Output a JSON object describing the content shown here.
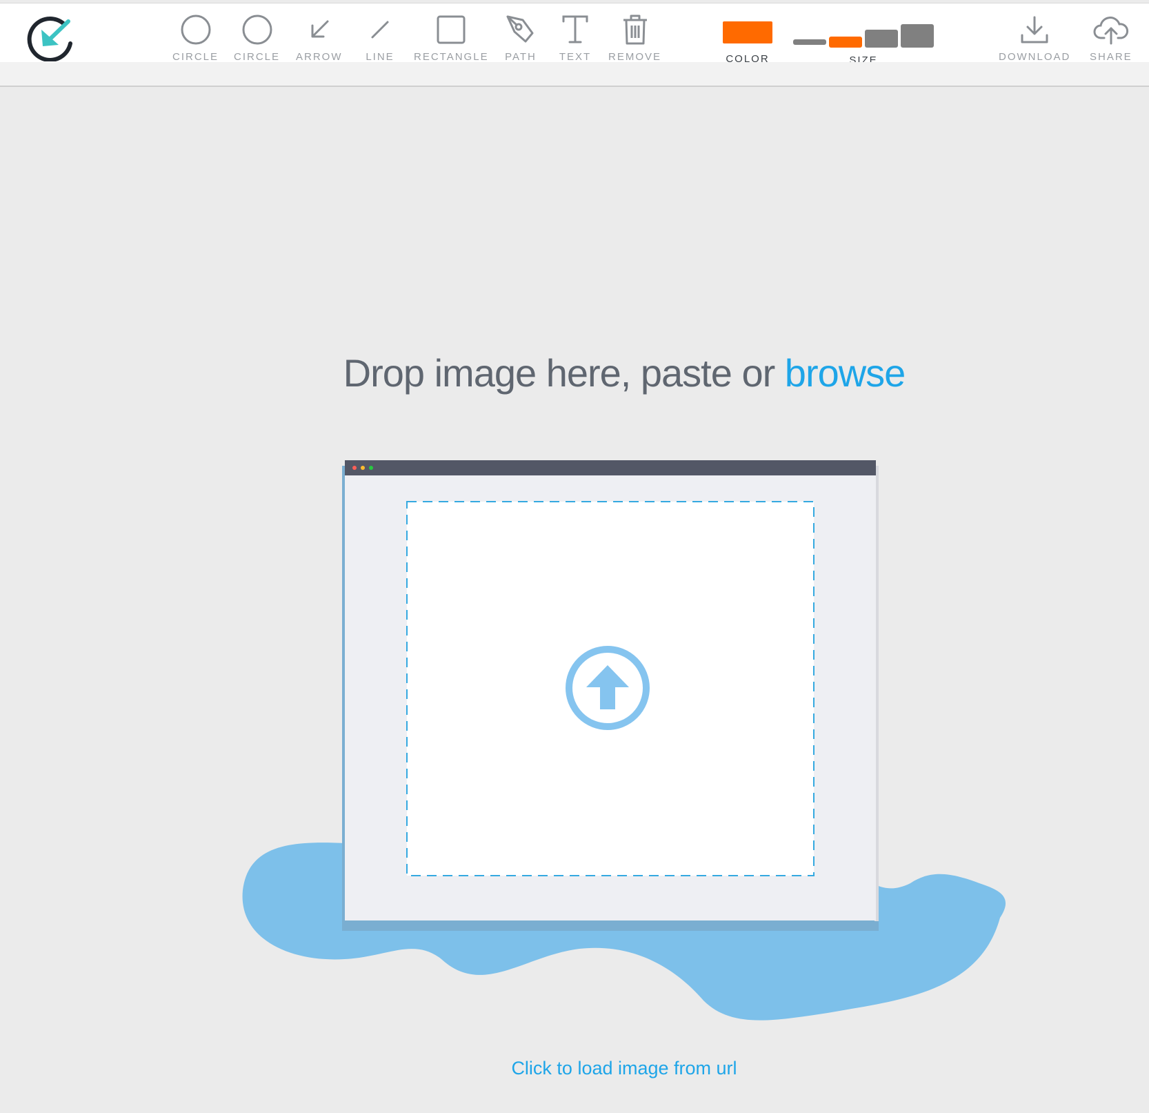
{
  "toolbar": {
    "tools": [
      {
        "label": "CIRCLE",
        "icon": "circle-icon"
      },
      {
        "label": "CIRCLE",
        "icon": "circle-icon"
      },
      {
        "label": "ARROW",
        "icon": "arrow-icon"
      },
      {
        "label": "LINE",
        "icon": "line-icon"
      },
      {
        "label": "RECTANGLE",
        "icon": "rectangle-icon"
      },
      {
        "label": "PATH",
        "icon": "pen-icon"
      },
      {
        "label": "TEXT",
        "icon": "text-icon"
      },
      {
        "label": "REMOVE",
        "icon": "trash-icon"
      }
    ],
    "color_label": "COLOR",
    "size_label": "SIZE",
    "selected_color": "#ff6a00",
    "selected_size_index": 1,
    "download_label": "DOWNLOAD",
    "share_label": "SHARE"
  },
  "main": {
    "drop_text": "Drop image here, paste or ",
    "browse_text": "browse",
    "url_link": "Click to load image from url"
  },
  "colors": {
    "accent": "#1ea5e8",
    "brand_teal": "#3cc3c3",
    "blob": "#7dc0ea"
  }
}
